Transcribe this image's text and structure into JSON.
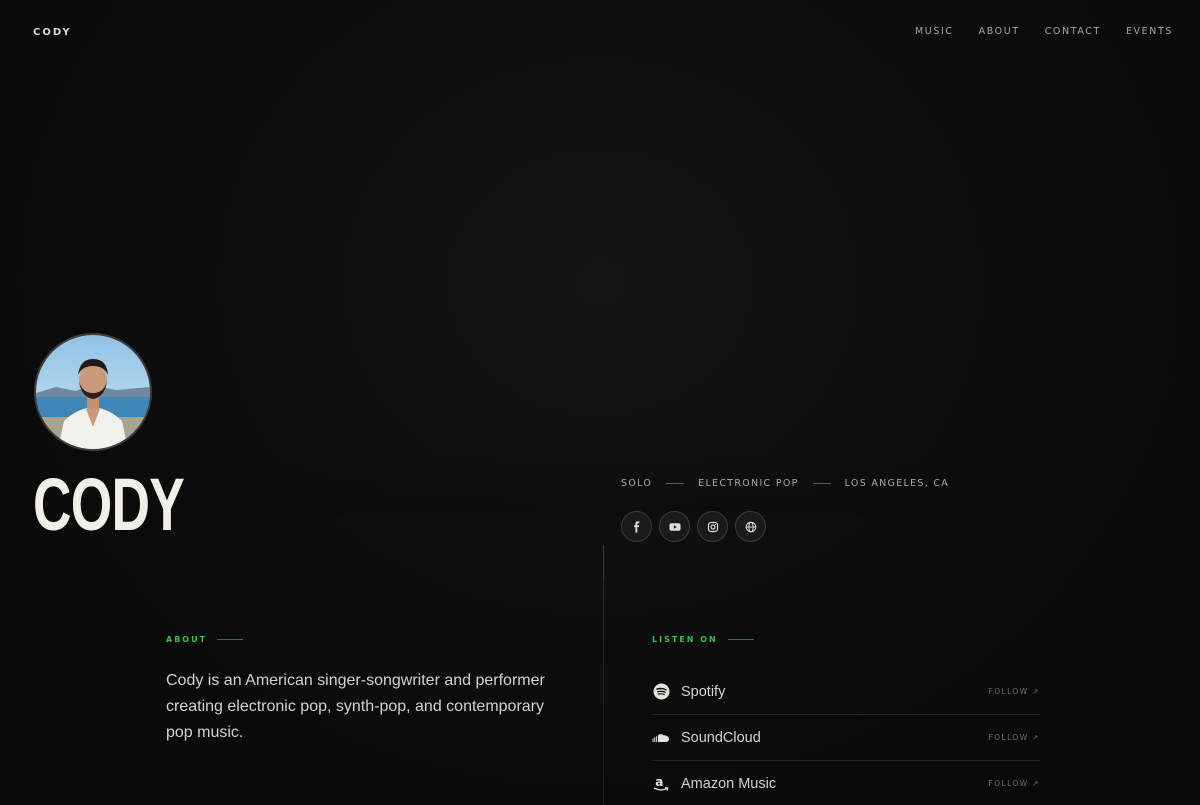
{
  "brand": {
    "logo_text": "CODY"
  },
  "nav": {
    "items": [
      {
        "label": "MUSIC"
      },
      {
        "label": "ABOUT"
      },
      {
        "label": "CONTACT"
      },
      {
        "label": "EVENTS"
      }
    ]
  },
  "hero": {
    "artist_name": "CODY",
    "meta": [
      "SOLO",
      "ELECTRONIC POP",
      "LOS ANGELES, CA"
    ],
    "socials": [
      {
        "icon": "facebook-icon"
      },
      {
        "icon": "youtube-icon"
      },
      {
        "icon": "instagram-icon"
      },
      {
        "icon": "globe-icon"
      }
    ]
  },
  "about": {
    "label": "ABOUT",
    "text": "Cody is an American singer-songwriter and performer creating electronic pop, synth-pop, and contemporary pop music."
  },
  "listen": {
    "label": "LISTEN ON",
    "services": [
      {
        "name": "Spotify",
        "icon": "spotify-icon",
        "action": "FOLLOW ↗"
      },
      {
        "name": "SoundCloud",
        "icon": "soundcloud-icon",
        "action": "FOLLOW ↗"
      },
      {
        "name": "Amazon Music",
        "icon": "amazon-icon",
        "action": "FOLLOW ↗"
      }
    ]
  },
  "colors": {
    "accent_green": "#37c24a",
    "wave_teal": "#1f8fa3",
    "wave_green": "#2fb04a",
    "wave_blue": "#2a7fb8",
    "wave_magenta": "#c42a86",
    "wave_pink": "#d0246e",
    "background": "#0b0b0b"
  }
}
